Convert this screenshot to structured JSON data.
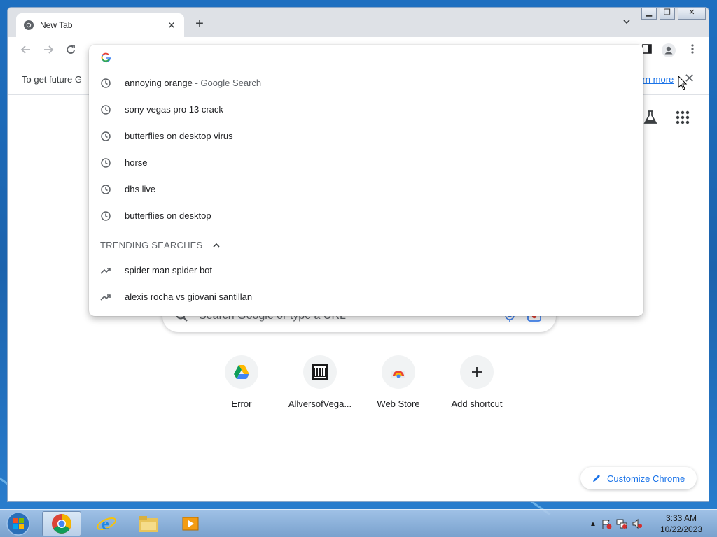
{
  "tab": {
    "title": "New Tab",
    "close_icon": "close-icon"
  },
  "toolbar": {
    "back": "back-arrow-icon",
    "forward": "forward-arrow-icon",
    "reload": "reload-icon"
  },
  "infobar": {
    "message": "To get future G",
    "link": "earn more"
  },
  "omnibox": {
    "input_value": "",
    "suggestions": [
      {
        "text": "annoying orange",
        "desc": " - Google Search",
        "icon": "history-clock-icon"
      },
      {
        "text": "sony vegas pro 13 crack",
        "desc": "",
        "icon": "history-clock-icon"
      },
      {
        "text": "butterflies on desktop virus",
        "desc": "",
        "icon": "history-clock-icon"
      },
      {
        "text": "horse",
        "desc": "",
        "icon": "history-clock-icon"
      },
      {
        "text": "dhs live",
        "desc": "",
        "icon": "history-clock-icon"
      },
      {
        "text": "butterflies on desktop",
        "desc": "",
        "icon": "history-clock-icon"
      }
    ],
    "trending_header": "TRENDING SEARCHES",
    "trending": [
      {
        "text": "spider man spider bot",
        "icon": "trending-arrow-icon"
      },
      {
        "text": "alexis rocha vs giovani santillan",
        "icon": "trending-arrow-icon"
      }
    ]
  },
  "ntp": {
    "search_placeholder": "Search Google or type a URL",
    "shortcuts": [
      {
        "label": "Error",
        "icon": "google-drive-icon"
      },
      {
        "label": "AllversofVega...",
        "icon": "museum-icon"
      },
      {
        "label": "Web Store",
        "icon": "web-store-icon"
      },
      {
        "label": "Add shortcut",
        "icon": "plus-icon"
      }
    ],
    "customize_label": "Customize Chrome"
  },
  "taskbar": {
    "time": "3:33 AM",
    "date": "10/22/2023",
    "apps": [
      "chrome-icon",
      "internet-explorer-icon",
      "file-explorer-icon",
      "media-player-icon"
    ]
  },
  "colors": {
    "accent": "#1a73e8",
    "text": "#202124",
    "muted": "#5f6368"
  }
}
